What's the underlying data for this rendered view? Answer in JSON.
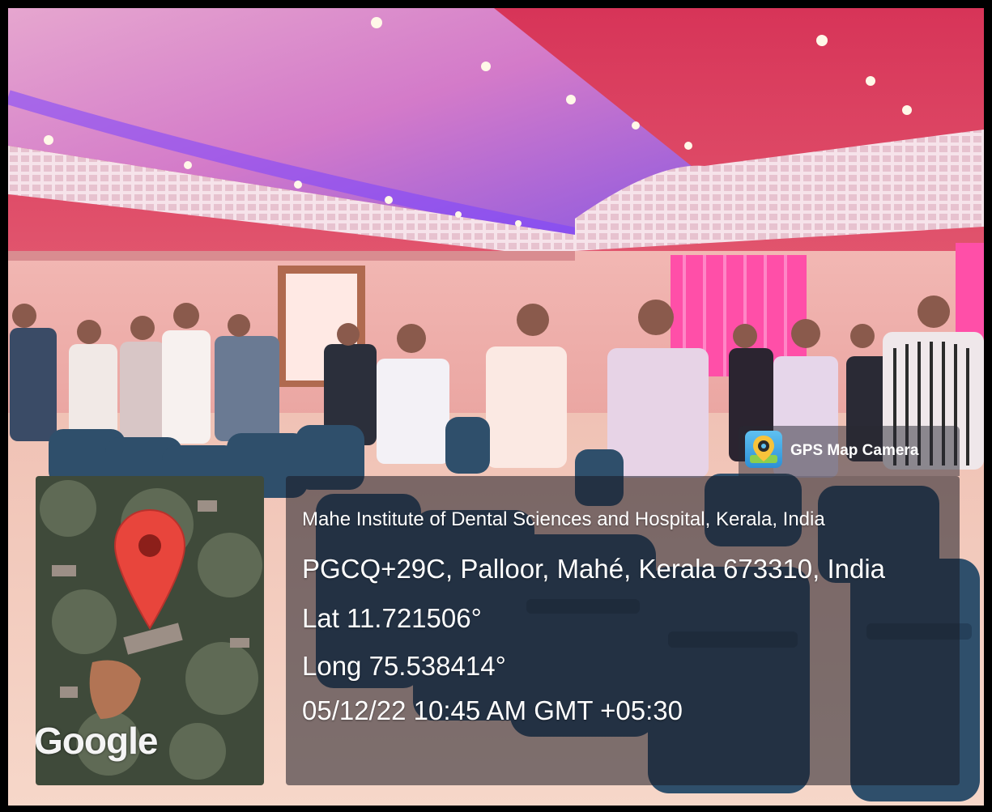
{
  "map": {
    "logo_text": "Google"
  },
  "app_badge": {
    "label": "GPS Map Camera",
    "icon": "map-pin-camera-icon"
  },
  "location": {
    "place": "Mahe Institute of Dental Sciences and Hospital, Kerala, India",
    "address": "PGCQ+29C, Palloor, Mahé, Kerala 673310, India",
    "latitude": "Lat 11.721506°",
    "longitude": "Long 75.538414°",
    "timestamp": "05/12/22 10:45 AM GMT +05:30"
  },
  "colors": {
    "frame": "#000000",
    "pin": "#e8453c",
    "ceiling": "#e0455f",
    "chairs": "#2f4f6b"
  }
}
